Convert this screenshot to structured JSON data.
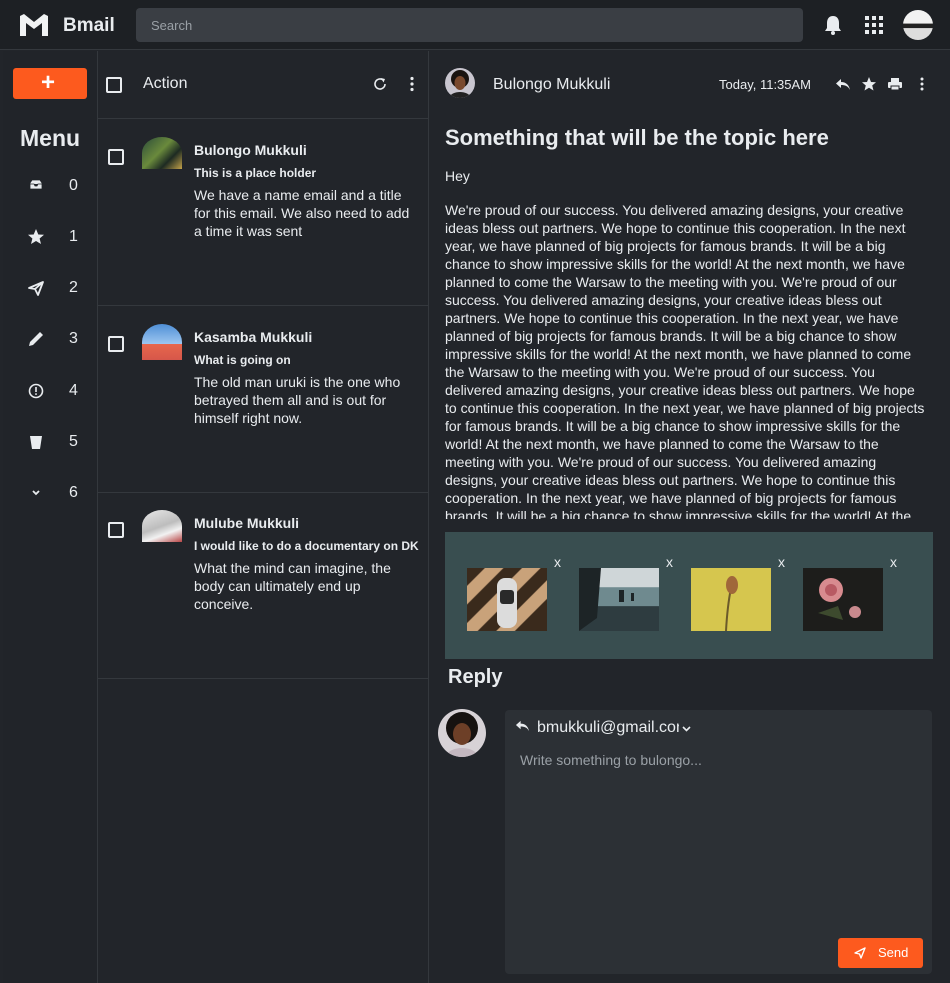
{
  "app": {
    "brand": "Bmail"
  },
  "search": {
    "placeholder": "Search"
  },
  "compose": {
    "label": "+"
  },
  "menu": {
    "title": "Menu",
    "items": [
      {
        "icon": "inbox-icon",
        "count": "0"
      },
      {
        "icon": "star-icon",
        "count": "1"
      },
      {
        "icon": "send-icon",
        "count": "2"
      },
      {
        "icon": "pencil-icon",
        "count": "3"
      },
      {
        "icon": "alert-icon",
        "count": "4"
      },
      {
        "icon": "trash-icon",
        "count": "5"
      },
      {
        "icon": "chevron-down-icon",
        "count": "6"
      }
    ]
  },
  "list": {
    "action_label": "Action",
    "mails": [
      {
        "from": "Bulongo Mukkuli",
        "subject": "This is a place holder",
        "snippet": "We have a name email and a title for this email. We also need to add a time it was sent"
      },
      {
        "from": "Kasamba Mukkuli",
        "subject": "What is going on",
        "snippet": "The old man uruki is the one who betrayed them all and is out for himself right now."
      },
      {
        "from": "Mulube Mukkuli",
        "subject": "I would like to do a documentary on DK",
        "snippet": "What the mind can imagine, the body can ultimately end up conceive."
      }
    ]
  },
  "reader": {
    "from": "Bulongo Mukkuli",
    "time": "Today, 11:35AM",
    "subject": "Something that will be the topic here",
    "greeting": "Hey",
    "body": "We're proud of our success. You delivered amazing designs, your creative ideas bless out partners. We hope to continue this cooperation. In the next year, we have planned of big projects for famous brands. It will be a big chance to show impressive skills for the world! At the next month, we have planned to come the Warsaw to the meeting with you. We're proud of our success. You delivered amazing designs, your creative ideas bless out partners. We hope to continue this cooperation. In the next year, we have planned of big projects for famous brands. It will be a big chance to show impressive skills for the world! At the next month, we have planned to come the Warsaw to the meeting with you. We're proud of our success. You delivered amazing designs, your creative ideas bless out partners. We hope to continue this cooperation. In the next year, we have planned of big projects for famous brands. It will be a big chance to show impressive skills for the world! At the next month, we have planned to come the Warsaw to the meeting with you. We're proud of our success. You delivered amazing designs, your creative ideas bless out partners. We hope to continue this cooperation. In the next year, we have planned of big projects for famous brands. It will be a big chance to show impressive skills for the world! At the next month, we have planned to come the Warsaw to the meeting with you.",
    "attachments": [
      {
        "remove": "x"
      },
      {
        "remove": "x"
      },
      {
        "remove": "x"
      },
      {
        "remove": "x"
      }
    ]
  },
  "reply": {
    "title": "Reply",
    "to": "bmukkuli@gmail.com",
    "placeholder": "Write something to bulongo...",
    "send_label": "Send"
  },
  "colors": {
    "accent": "#fd5a1e",
    "background": "#22252a",
    "attachment_bg": "#394e50"
  }
}
